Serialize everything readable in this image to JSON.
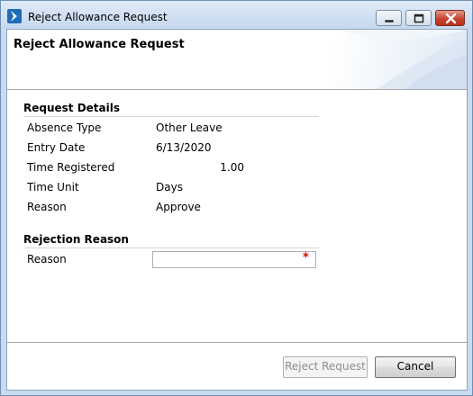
{
  "window": {
    "title": "Reject Allowance Request",
    "controls": {
      "minimize": "minimize",
      "maximize": "maximize",
      "close": "close"
    }
  },
  "header": {
    "title": "Reject Allowance Request"
  },
  "request_details": {
    "section_title": "Request Details",
    "fields": [
      {
        "label": "Absence Type",
        "value": "Other Leave"
      },
      {
        "label": "Entry Date",
        "value": "6/13/2020"
      },
      {
        "label": "Time Registered",
        "value": "1.00"
      },
      {
        "label": "Time Unit",
        "value": "Days"
      },
      {
        "label": "Reason",
        "value": "Approve"
      }
    ]
  },
  "rejection": {
    "section_title": "Rejection Reason",
    "reason_label": "Reason",
    "reason_value": "",
    "required_marker": "*"
  },
  "buttons": {
    "reject_label": "Reject Request",
    "cancel_label": "Cancel"
  },
  "icons": {
    "app": "app-chevron-icon",
    "minimize": "minimize-icon",
    "maximize": "maximize-icon",
    "close": "close-icon"
  },
  "colors": {
    "titlebar": "#c6d8ee",
    "close_button": "#c8412e",
    "required": "#e00000",
    "disabled_text": "#8d8d8d"
  }
}
